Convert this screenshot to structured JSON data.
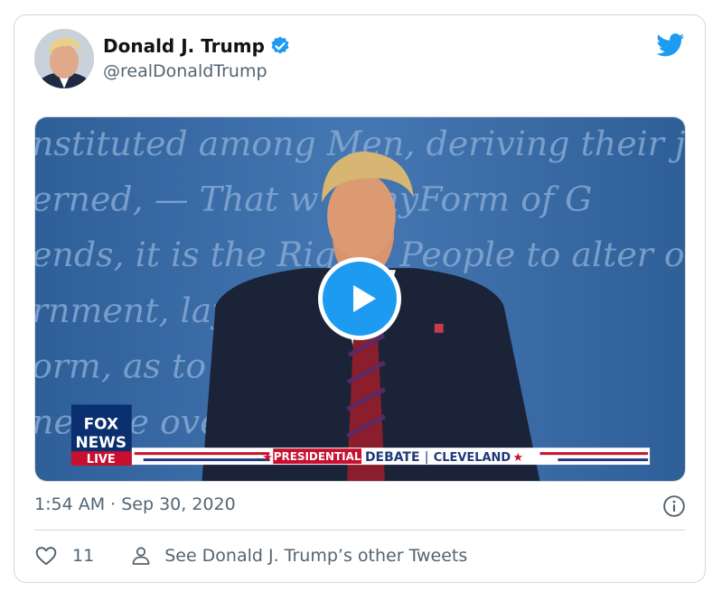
{
  "author": {
    "name": "Donald J. Trump",
    "handle": "@realDonaldTrump",
    "verified": true,
    "avatar_icon": "avatar-photo"
  },
  "brand_icon": "twitter-bird-icon",
  "media": {
    "type": "video",
    "play_icon": "play-icon",
    "background_script": [
      "nstituted among Men, deriving their ju",
      "erned, — That w      r anyForm of G",
      "ends, it is the Righ     e People to alter or",
      "rnment, layi              such princi",
      "orm, as to t               kely to effe",
      "ne   nde                  overnmen"
    ],
    "chyron": {
      "logo_top": "FOX",
      "logo_bottom": "NEWS",
      "live": "LIVE",
      "presidential": "PRESIDENTIAL",
      "debate": "DEBATE",
      "city": "CLEVELAND"
    }
  },
  "timestamp": "1:54 AM · Sep 30, 2020",
  "info_icon": "info-icon",
  "actions": {
    "like_count": "11",
    "other_tweets_label": "See Donald J. Trump’s other Tweets"
  },
  "colors": {
    "accent": "#1d9bf0",
    "text_primary": "#0f1419",
    "text_secondary": "#536471",
    "border": "#cfd9de",
    "backdrop_blue": "#3e6fa8",
    "fox_red": "#c8102e"
  }
}
